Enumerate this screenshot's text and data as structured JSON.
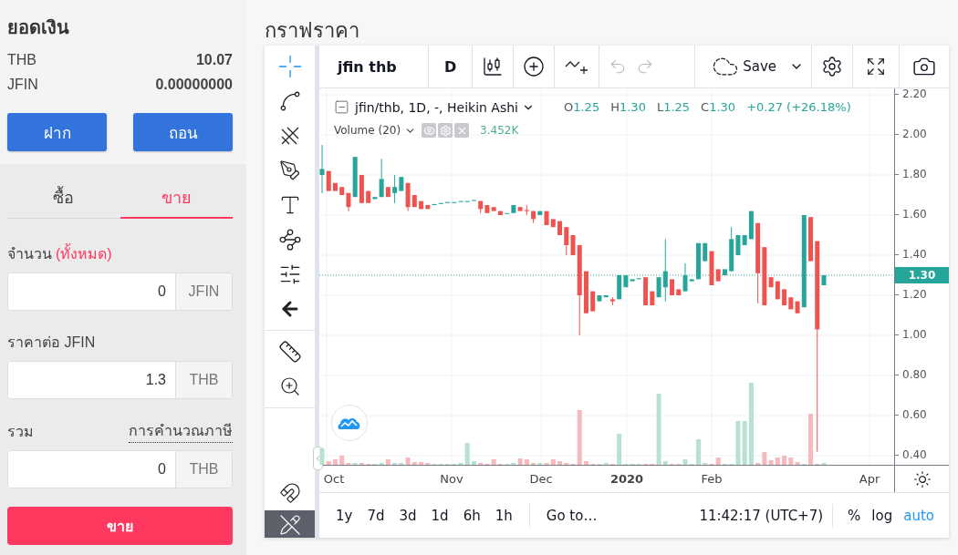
{
  "balance": {
    "title": "ยอดเงิน",
    "rows": [
      {
        "currency": "THB",
        "amount": "10.07"
      },
      {
        "currency": "JFIN",
        "amount": "0.00000000"
      }
    ],
    "buttons": [
      "ฝาก",
      "ถอน"
    ]
  },
  "trade_tabs": [
    {
      "label": "ซื้อ",
      "selected": false
    },
    {
      "label": "ขาย",
      "selected": true
    }
  ],
  "form": {
    "fields": [
      {
        "label": "จำนวน",
        "link": "(ทั้งหมด)",
        "value": "0",
        "unit": "JFIN"
      },
      {
        "label": "ราคาต่อ JFIN",
        "value": "1.3",
        "unit": "THB"
      },
      {
        "label": "รวม",
        "hint": "การคำนวณภาษี",
        "value": "0",
        "unit": "THB"
      }
    ],
    "submit": "ขาย"
  },
  "chart_panel": {
    "title": "กราฟราคา",
    "symbol": "jfin thb",
    "interval": "D",
    "save": "Save",
    "legend": {
      "series": "jfin/thb, 1D, -, Heikin Ashi",
      "ohlc": [
        {
          "label": "O",
          "value": "1.25"
        },
        {
          "label": "H",
          "value": "1.30"
        },
        {
          "label": "L",
          "value": "1.25"
        },
        {
          "label": "C",
          "value": "1.30"
        }
      ],
      "change": "+0.27 (+26.18%)",
      "volume": "Volume (20)",
      "volume_value": "3.452K"
    },
    "price_axis": [
      "2.20",
      "2.00",
      "1.80",
      "1.60",
      "1.40",
      "1.20",
      "1.00",
      "0.80",
      "0.60",
      "0.40"
    ],
    "last_price": "1.30",
    "time_axis": [
      {
        "label": "Oct",
        "kind": "month"
      },
      {
        "label": "Nov",
        "kind": "month"
      },
      {
        "label": "Dec",
        "kind": "month"
      },
      {
        "label": "2020",
        "kind": "year"
      },
      {
        "label": "Feb",
        "kind": "month"
      },
      {
        "label": "Apr",
        "kind": "month"
      }
    ],
    "ranges": [
      "1y",
      "7d",
      "3d",
      "1d",
      "6h",
      "1h"
    ],
    "goto": "Go to…",
    "clock": "11:42:17 (UTC+7)",
    "scale_options": [
      {
        "label": "%",
        "selected": false
      },
      {
        "label": "log",
        "selected": false
      },
      {
        "label": "auto",
        "selected": true
      }
    ]
  }
}
